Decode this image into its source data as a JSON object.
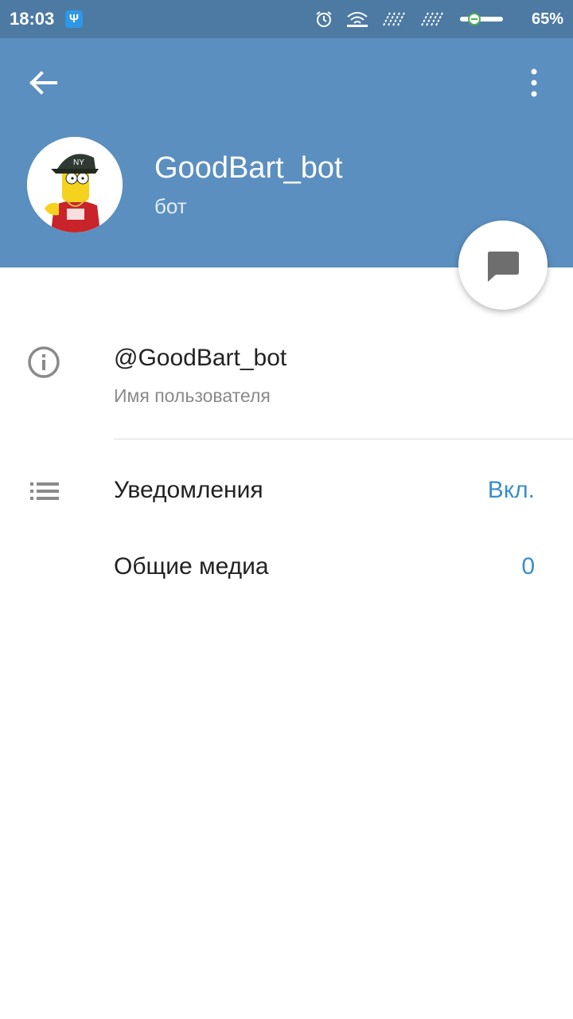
{
  "status_bar": {
    "time": "18:03",
    "app_icon_glyph": "Ψ",
    "battery": "65%",
    "icons": [
      "alarm-icon",
      "wifi-icon",
      "signal-icon",
      "signal-icon",
      "battery-icon"
    ]
  },
  "header": {
    "bot_name": "GoodBart_bot",
    "bot_status": "бот",
    "icons": [
      "back-arrow-icon",
      "more-vertical-icon",
      "message-icon"
    ]
  },
  "info": {
    "username": "@GoodBart_bot",
    "username_caption": "Имя пользователя"
  },
  "settings": {
    "notifications_label": "Уведомления",
    "notifications_value": "Вкл.",
    "media_label": "Общие медиа",
    "media_value": "0"
  },
  "colors": {
    "header_bg": "#5b8fbf",
    "status_bg": "#4c7aa3",
    "accent": "#3a8ecd"
  }
}
